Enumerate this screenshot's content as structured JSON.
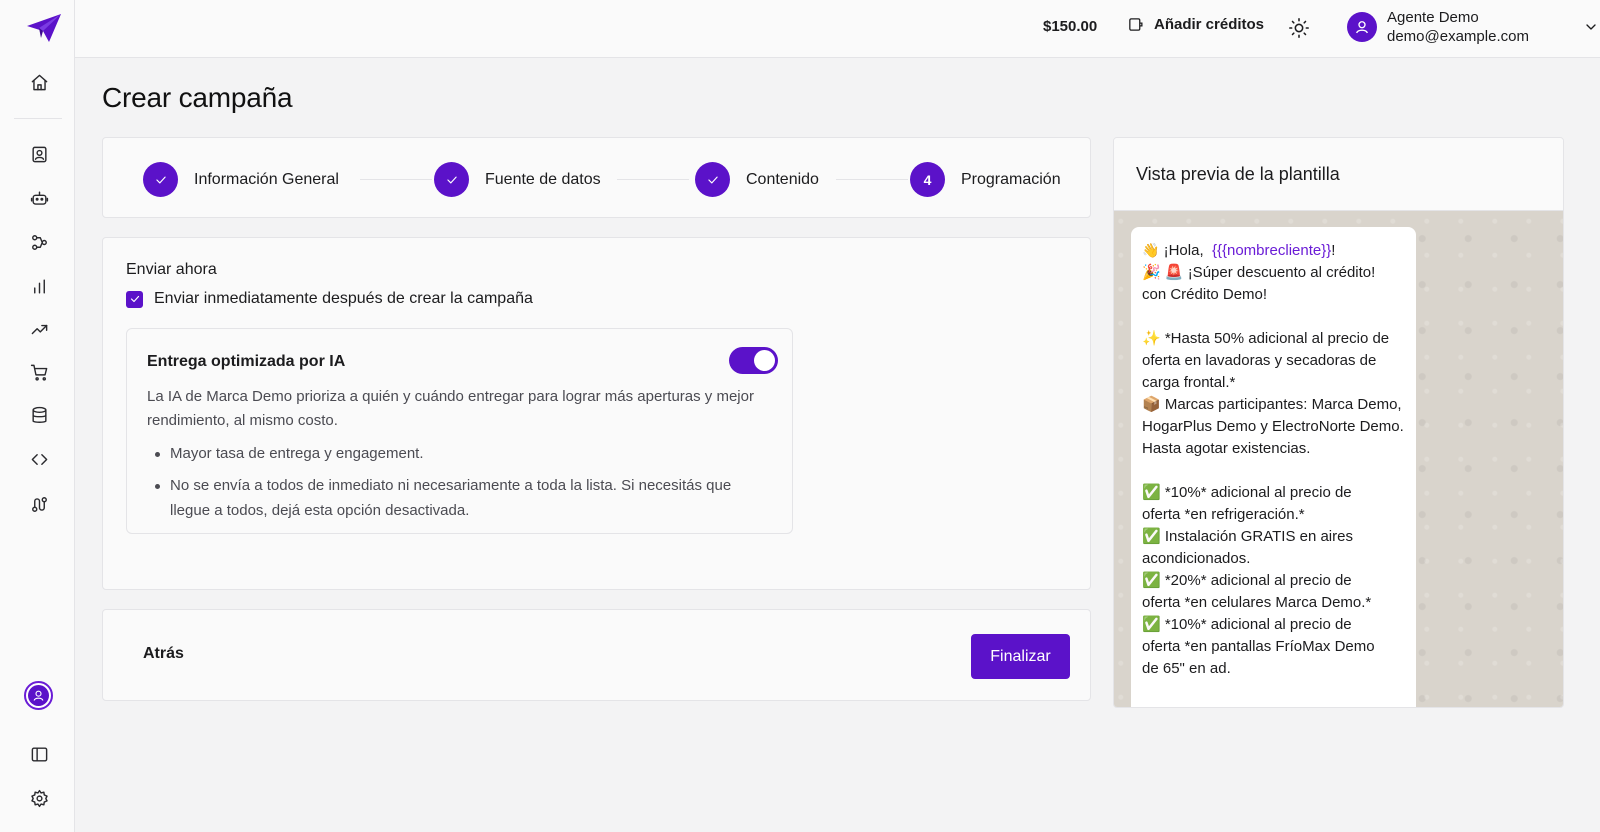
{
  "topbar": {
    "balance": "$150.00",
    "add_credits": "Añadir créditos",
    "user_name": "Agente Demo",
    "user_email": "demo@example.com"
  },
  "page": {
    "title": "Crear campaña"
  },
  "stepper": {
    "steps": [
      {
        "label": "Información General",
        "state": "done"
      },
      {
        "label": "Fuente de datos",
        "state": "done"
      },
      {
        "label": "Contenido",
        "state": "done"
      },
      {
        "label": "Programación",
        "state": "current",
        "number": "4"
      }
    ]
  },
  "schedule": {
    "title": "Enviar ahora",
    "checkbox_label": "Enviar inmediatamente después de crear la campaña",
    "checkbox_checked": true,
    "ai": {
      "title": "Entrega optimizada por IA",
      "enabled": true,
      "description": "La IA de Marca Demo prioriza a quién y cuándo entregar para lograr más aperturas y mejor rendimiento, al mismo costo.",
      "bullets": [
        "Mayor tasa de entrega y engagement.",
        "No se envía a todos de inmediato ni necesariamente a toda la lista. Si necesitás que llegue a todos, dejá esta opción desactivada."
      ]
    }
  },
  "footer": {
    "back": "Atrás",
    "finish": "Finalizar"
  },
  "preview": {
    "title": "Vista previa de la plantilla",
    "greeting_emoji": "👋",
    "greeting": "¡Hola,",
    "variable": "{{{nombrecliente}}",
    "greeting_end": "!",
    "lines": [
      "🎉 🚨 ¡Súper descuento al crédito!",
      "con Crédito Demo!",
      "",
      "✨ *Hasta 50% adicional al precio de",
      "oferta en lavadoras y secadoras de",
      "carga frontal.*",
      "📦 Marcas participantes: Marca Demo,",
      "HogarPlus Demo y ElectroNorte Demo.",
      "Hasta agotar existencias.",
      "",
      "✅ *10%* adicional al precio de",
      "oferta *en refrigeración.*",
      "✅ Instalación GRATIS en aires",
      "acondicionados.",
      "✅ *20%* adicional al precio de",
      "oferta *en celulares Marca Demo.*",
      "✅ *10%* adicional al precio de",
      "oferta *en pantallas FríoMax Demo",
      "de 65\" en ad."
    ]
  },
  "colors": {
    "accent": "#5b12c9",
    "background": "#f3f3f4",
    "surface": "#fafafa",
    "border": "#e4e4e7"
  },
  "icons": {
    "sidebar": [
      "home-icon",
      "contacts-icon",
      "bot-icon",
      "workflow-icon",
      "bar-chart-icon",
      "trending-icon",
      "cart-icon",
      "database-icon",
      "code-icon",
      "integrations-icon",
      "user-avatar-icon",
      "panel-toggle-icon",
      "settings-icon"
    ]
  }
}
